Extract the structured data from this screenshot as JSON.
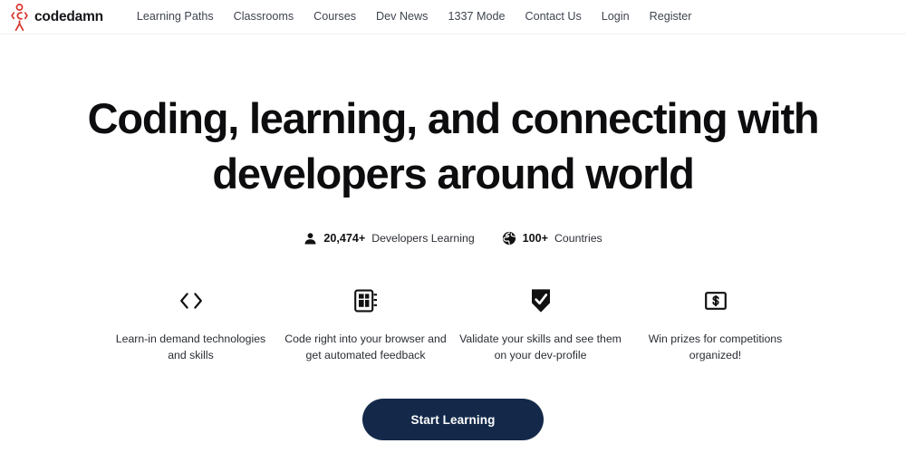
{
  "brand": {
    "logo_icon": "codedamn-stickman-logo-icon",
    "wordmark": "codedamn",
    "accent_color": "#d9342b"
  },
  "nav": {
    "items": [
      {
        "label": "Learning Paths"
      },
      {
        "label": "Classrooms"
      },
      {
        "label": "Courses"
      },
      {
        "label": "Dev News"
      },
      {
        "label": "1337 Mode"
      },
      {
        "label": "Contact Us"
      },
      {
        "label": "Login"
      },
      {
        "label": "Register"
      }
    ]
  },
  "hero": {
    "title": "Coding, learning, and connecting with developers around world"
  },
  "stats": [
    {
      "icon": "user-icon",
      "value": "20,474+",
      "label": "Developers Learning"
    },
    {
      "icon": "globe-icon",
      "value": "100+",
      "label": "Countries"
    }
  ],
  "features": [
    {
      "icon": "code-brackets-icon",
      "text": "Learn-in demand technologies and skills"
    },
    {
      "icon": "browser-window-icon",
      "text": "Code right into your browser and get automated feedback"
    },
    {
      "icon": "shield-check-icon",
      "text": "Validate your skills and see them on your dev-profile"
    },
    {
      "icon": "money-dollar-icon",
      "text": "Win prizes for competitions organized!"
    }
  ],
  "cta": {
    "label": "Start Learning",
    "background_color": "#14294a",
    "text_color": "#ffffff"
  }
}
